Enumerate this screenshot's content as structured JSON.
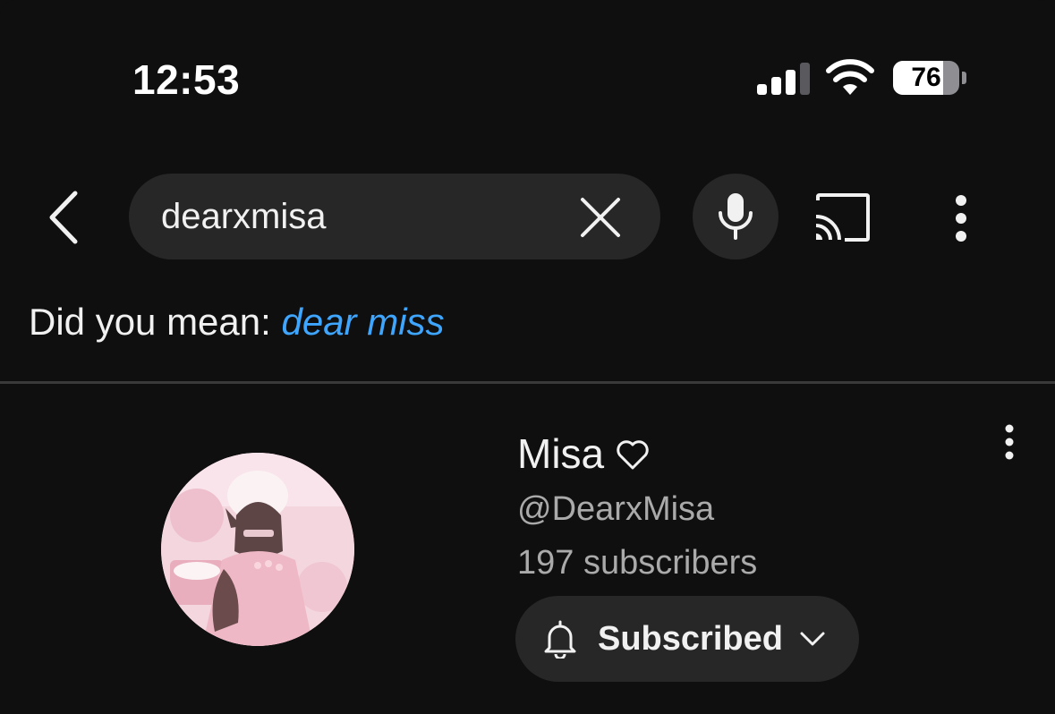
{
  "status_bar": {
    "time": "12:53",
    "battery_level": "76",
    "battery_fraction": 0.76,
    "icons": [
      "signal-icon",
      "wifi-icon",
      "battery-icon"
    ]
  },
  "search": {
    "query": "dearxmisa",
    "icons": [
      "back-arrow-icon",
      "close-icon",
      "microphone-icon",
      "cast-icon",
      "more-vertical-icon"
    ]
  },
  "suggestion": {
    "prefix": "Did you mean: ",
    "suggested_query": "dear miss"
  },
  "channel": {
    "name": "Misa",
    "handle": "@DearxMisa",
    "subscribers": "197 subscribers",
    "subscribe_label": "Subscribed",
    "icons": [
      "heart-icon",
      "bell-icon",
      "chevron-down-icon",
      "more-vertical-icon"
    ]
  },
  "colors": {
    "background": "#0f0f0f",
    "surface": "#272727",
    "primary_text": "#f1f1f1",
    "secondary_text": "#aaaaaa",
    "link": "#3ea6ff",
    "divider": "#3a3a3a"
  }
}
